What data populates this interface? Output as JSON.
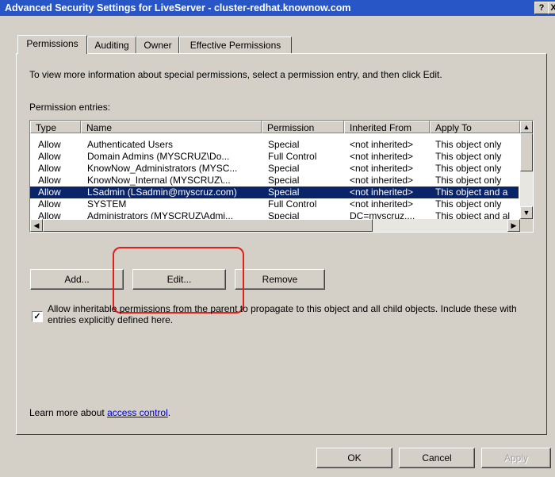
{
  "window": {
    "title": "Advanced Security Settings for LiveServer - cluster-redhat.knownow.com",
    "help_label": "?",
    "close_label": "X"
  },
  "tabs": [
    {
      "label": "Permissions",
      "active": true
    },
    {
      "label": "Auditing",
      "active": false
    },
    {
      "label": "Owner",
      "active": false
    },
    {
      "label": "Effective Permissions",
      "active": false
    }
  ],
  "intro_text": "To view more information about special permissions, select a permission entry, and then click Edit.",
  "entries_label": "Permission entries:",
  "table": {
    "columns": [
      "Type",
      "Name",
      "Permission",
      "Inherited From",
      "Apply To"
    ],
    "rows": [
      {
        "type": "Allow",
        "name": "Authenticated Users",
        "permission": "Special",
        "inherited": "<not inherited>",
        "apply": "This object only",
        "selected": false
      },
      {
        "type": "Allow",
        "name": "Domain Admins (MYSCRUZ\\Do...",
        "permission": "Full Control",
        "inherited": "<not inherited>",
        "apply": "This object only",
        "selected": false
      },
      {
        "type": "Allow",
        "name": "KnowNow_Administrators (MYSC...",
        "permission": "Special",
        "inherited": "<not inherited>",
        "apply": "This object only",
        "selected": false
      },
      {
        "type": "Allow",
        "name": "KnowNow_Internal (MYSCRUZ\\...",
        "permission": "Special",
        "inherited": "<not inherited>",
        "apply": "This object only",
        "selected": false
      },
      {
        "type": "Allow",
        "name": "LSadmin (LSadmin@myscruz.com)",
        "permission": "Special",
        "inherited": "<not inherited>",
        "apply": "This object and a",
        "selected": true
      },
      {
        "type": "Allow",
        "name": "SYSTEM",
        "permission": "Full Control",
        "inherited": "<not inherited>",
        "apply": "This object only",
        "selected": false
      },
      {
        "type": "Allow",
        "name": "Administrators (MYSCRUZ\\Admi...",
        "permission": "Special",
        "inherited": "DC=myscruz,...",
        "apply": "This object and al",
        "selected": false
      }
    ]
  },
  "buttons": {
    "add": "Add...",
    "edit": "Edit...",
    "remove": "Remove",
    "ok": "OK",
    "cancel": "Cancel",
    "apply": "Apply"
  },
  "inherit_checkbox": {
    "checked": true,
    "label": "Allow inheritable permissions from the parent to propagate to this object and all child objects. Include these with entries explicitly defined here."
  },
  "learn_more": {
    "prefix": "Learn more about ",
    "link": "access control",
    "suffix": "."
  },
  "colors": {
    "titlebar": "#2856c6",
    "selection": "#0a246a",
    "annotation": "#e0201c"
  }
}
